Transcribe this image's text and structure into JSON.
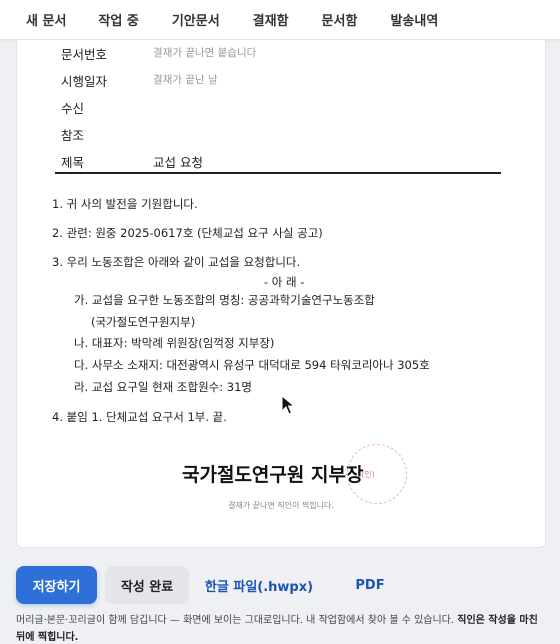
{
  "nav": {
    "tabs": [
      "새 문서",
      "작업 중",
      "기안문서",
      "결재함",
      "문서함",
      "발송내역"
    ]
  },
  "header": {
    "doc_number": {
      "label": "문서번호",
      "value": "결재가 끝나면 붙습니다"
    },
    "effective_date": {
      "label": "시행일자",
      "value": "결재가 끝난 날"
    },
    "recipient": {
      "label": "수신",
      "value": ""
    },
    "reference": {
      "label": "참조",
      "value": ""
    },
    "subject": {
      "label": "제목",
      "value": "교섭 요청"
    }
  },
  "body": {
    "lines": [
      "1. 귀 사의 발전을 기원합니다.",
      "2. 관련: 원중 2025-0617호 (단체교섭 요구 사실 공고)",
      "3. 우리 노동조합은 아래와 같이 교섭을 요청합니다.",
      "- 아 래 -",
      "가. 교섭을 요구한 노동조합의 명칭: 공공과학기술연구노동조합",
      "(국가절도연구원지부)",
      "나. 대표자: 박막례 위원장(임꺽정 지부장)",
      "다. 사무소 소재지: 대전광역시 유성구 대덕대로 594 타워코리아나 305호",
      "라. 교섭 요구일 현재 조합원수: 31명",
      "4. 붙임 1. 단체교섭 요구서 1부. 끝."
    ]
  },
  "signature": {
    "name": "국가절도연구원 지부장",
    "seal_text": "(인)",
    "note": "결재가 끝나면 직인이 찍힙니다."
  },
  "actions": {
    "save": "저장하기",
    "complete": "작성 완료",
    "hwpx": "한글 파일(.hwpx)",
    "pdf": "PDF"
  },
  "footnote": {
    "text": "머리글·본문·꼬리글이 함께 담깁니다 — 화면에 보이는 그대로입니다. 내 작업함에서 찾아 볼 수 있습니다. ",
    "bold": "직인은 작성을 마친 뒤에 찍힙니다."
  }
}
